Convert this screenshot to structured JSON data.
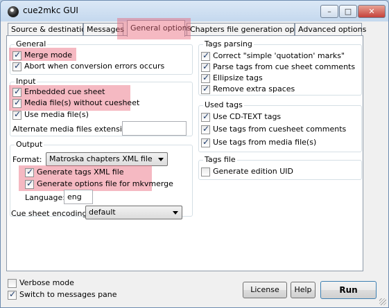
{
  "window": {
    "title": "cue2mkc GUI",
    "minimize_glyph": "–",
    "maximize_glyph": "□",
    "close_glyph": "✕"
  },
  "tabs": [
    {
      "label": "Source & destination"
    },
    {
      "label": "Messages"
    },
    {
      "label": "General options"
    },
    {
      "label": "Chapters file generation options"
    },
    {
      "label": "Advanced options"
    }
  ],
  "general": {
    "title": "General",
    "merge_mode": "Merge mode",
    "abort": "Abort when conversion errors occurs"
  },
  "input": {
    "title": "Input",
    "embedded": "Embedded cue sheet",
    "media_without": "Media file(s) without cuesheet",
    "use_media": "Use media file(s)",
    "alt_ext_label": "Alternate media files extensions:",
    "alt_ext_value": ""
  },
  "output": {
    "title": "Output",
    "format_label": "Format:",
    "format_value": "Matroska chapters XML file",
    "gen_tags": "Generate tags XML file",
    "gen_options": "Generate options file for mkvmerge",
    "language_label": "Language:",
    "language_value": "eng"
  },
  "encoding": {
    "label": "Cue sheet encoding:",
    "value": "default"
  },
  "tags_parsing": {
    "title": "Tags parsing",
    "items": [
      "Correct \"simple 'quotation' marks\"",
      "Parse tags from cue sheet comments",
      "Ellipsize tags",
      "Remove extra spaces"
    ]
  },
  "used_tags": {
    "title": "Used tags",
    "items": [
      "Use CD-TEXT tags",
      "Use tags from cuesheet comments",
      "Use tags from media file(s)"
    ]
  },
  "tags_file": {
    "title": "Tags file",
    "gen_uid": "Generate edition UID"
  },
  "bottom": {
    "verbose": "Verbose mode",
    "switch": "Switch to messages pane",
    "license": "License",
    "help": "Help",
    "run": "Run"
  },
  "colors": {
    "highlight": "#e86478",
    "title_bar": "#c4d8ee",
    "close_button": "#c5413a"
  }
}
